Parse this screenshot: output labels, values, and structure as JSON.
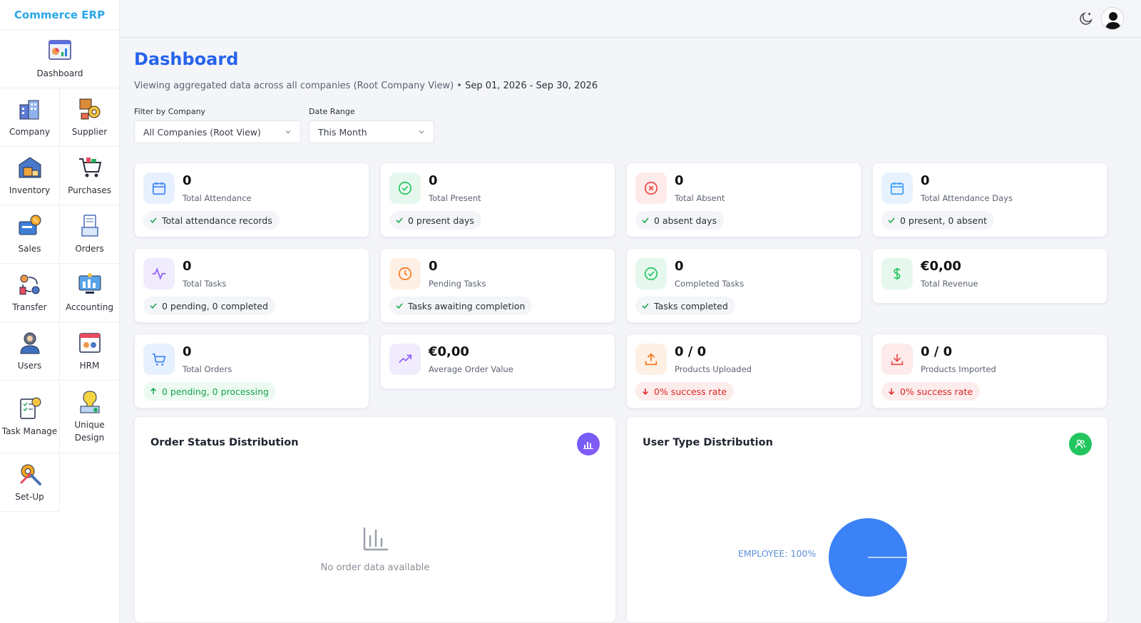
{
  "app": {
    "brand": "Commerce ERP"
  },
  "sidebar": {
    "items": [
      {
        "label": "Dashboard",
        "icon": "dashboard-icon"
      },
      {
        "label": "Company",
        "icon": "company-icon"
      },
      {
        "label": "Supplier",
        "icon": "supplier-icon"
      },
      {
        "label": "Inventory",
        "icon": "inventory-icon"
      },
      {
        "label": "Purchases",
        "icon": "purchases-icon"
      },
      {
        "label": "Sales",
        "icon": "sales-icon"
      },
      {
        "label": "Orders",
        "icon": "orders-icon"
      },
      {
        "label": "Transfer",
        "icon": "transfer-icon"
      },
      {
        "label": "Accounting",
        "icon": "accounting-icon"
      },
      {
        "label": "Users",
        "icon": "users-icon"
      },
      {
        "label": "HRM",
        "icon": "hrm-icon"
      },
      {
        "label": "Task Manage",
        "icon": "task-manage-icon"
      },
      {
        "label": "Unique Design",
        "icon": "unique-design-icon"
      },
      {
        "label": "Set-Up",
        "icon": "setup-icon"
      }
    ]
  },
  "header": {
    "title": "Dashboard",
    "subtitle": "Viewing aggregated data across all companies (Root Company View) • ",
    "date_range": "Sep 01, 2026 - Sep 30, 2026"
  },
  "filters": {
    "company_label": "Filter by Company",
    "company_value": "All Companies (Root View)",
    "date_label": "Date Range",
    "date_value": "This Month"
  },
  "stats": [
    {
      "value": "0",
      "label": "Total Attendance",
      "note": "Total attendance records",
      "icon": "calendar-icon",
      "color": "#3b82f6"
    },
    {
      "value": "0",
      "label": "Total Present",
      "note": "0 present days",
      "icon": "check-circle-icon",
      "color": "#22c55e"
    },
    {
      "value": "0",
      "label": "Total Absent",
      "note": "0 absent days",
      "icon": "x-circle-icon",
      "color": "#ef4444"
    },
    {
      "value": "0",
      "label": "Total Attendance Days",
      "note": "0 present, 0 absent",
      "icon": "calendar-icon",
      "color": "#3b82f6"
    },
    {
      "value": "0",
      "label": "Total Tasks",
      "note": "0 pending, 0 completed",
      "icon": "activity-icon",
      "color": "#8b5cf6"
    },
    {
      "value": "0",
      "label": "Pending Tasks",
      "note": "Tasks awaiting completion",
      "icon": "clock-icon",
      "color": "#f97316"
    },
    {
      "value": "0",
      "label": "Completed Tasks",
      "note": "Tasks completed",
      "icon": "check-circle-icon",
      "color": "#22c55e"
    },
    {
      "value": "€0,00",
      "label": "Total Revenue",
      "note": "",
      "icon": "dollar-icon",
      "color": "#22c55e"
    },
    {
      "value": "0",
      "label": "Total Orders",
      "note": "0 pending, 0 processing",
      "icon": "cart-icon",
      "color": "#3b82f6"
    },
    {
      "value": "€0,00",
      "label": "Average Order Value",
      "note": "",
      "icon": "trending-up-icon",
      "color": "#8b5cf6"
    },
    {
      "value": "0 / 0",
      "label": "Products Uploaded",
      "note": "0% success rate",
      "icon": "upload-icon",
      "color": "#f97316"
    },
    {
      "value": "0 / 0",
      "label": "Products Imported",
      "note": "0% success rate",
      "icon": "download-icon",
      "color": "#ef4444"
    }
  ],
  "panels": {
    "order_status": {
      "title": "Order Status Distribution",
      "empty_text": "No order data available"
    },
    "user_type": {
      "title": "User Type Distribution"
    }
  },
  "chart_data": {
    "type": "pie",
    "title": "User Type Distribution",
    "categories": [
      "EMPLOYEE"
    ],
    "values": [
      100
    ],
    "labels": [
      "EMPLOYEE: 100%"
    ],
    "colors": [
      "#3b82f6"
    ]
  }
}
